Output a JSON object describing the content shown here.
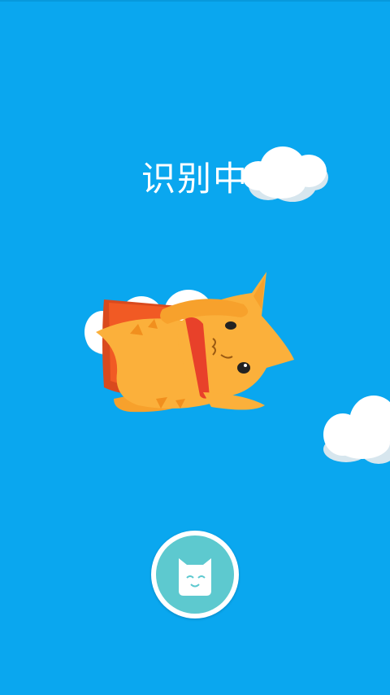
{
  "status": {
    "text": "识别中"
  },
  "colors": {
    "sky": "#0aa7ef",
    "cloud": "#ffffff",
    "cat_body": "#fbb03b",
    "cape": "#f15a24",
    "button_fill": "#5dc9cf"
  },
  "icons": {
    "fab": "cat-face-icon",
    "mascot": "flying-cat-mascot"
  }
}
